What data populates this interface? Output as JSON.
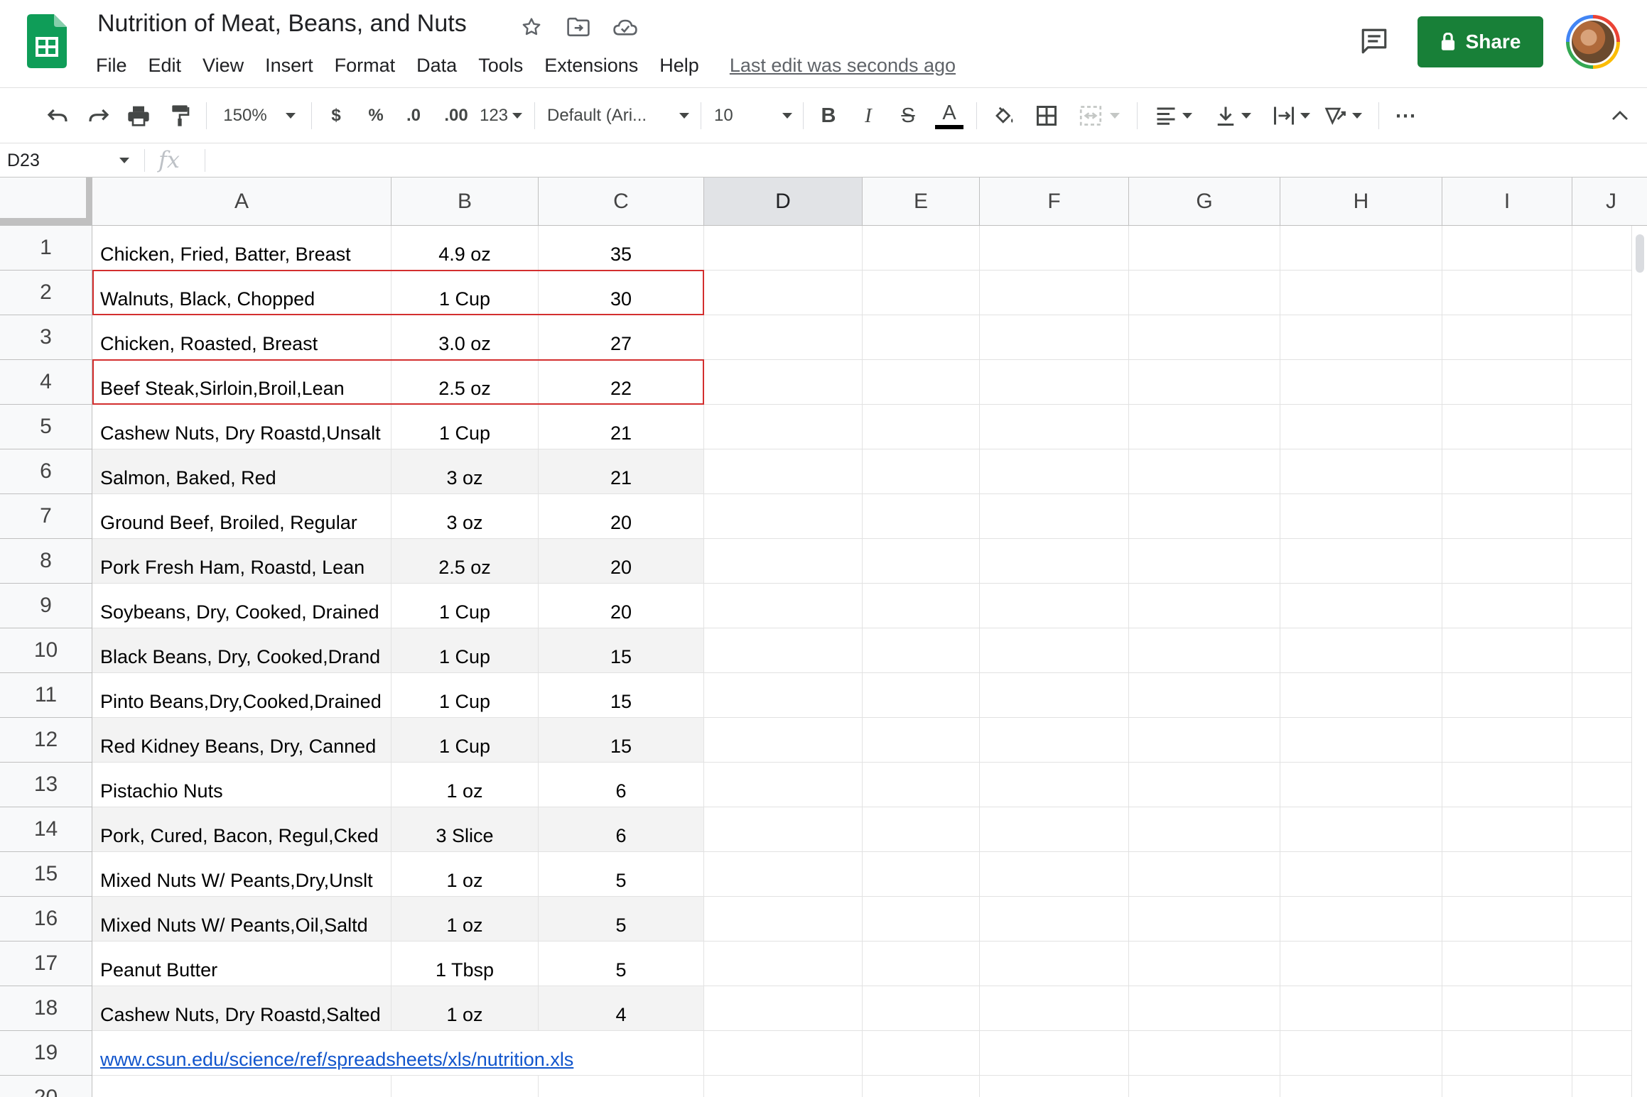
{
  "document": {
    "title": "Nutrition of Meat, Beans, and Nuts"
  },
  "menu": [
    "File",
    "Edit",
    "View",
    "Insert",
    "Format",
    "Data",
    "Tools",
    "Extensions",
    "Help"
  ],
  "status": {
    "last_edit": "Last edit was seconds ago"
  },
  "share": {
    "label": "Share"
  },
  "toolbar": {
    "zoom": "150%",
    "currency": "$",
    "percent": "%",
    "decrease_decimal": ".0",
    "increase_decimal": ".00",
    "more_formats": "123",
    "font": "Default (Ari...",
    "font_size": "10",
    "bold": "B",
    "italic": "I",
    "strikethrough": "S",
    "text_color": "A",
    "more": "⋯"
  },
  "formula_bar": {
    "cell_ref": "D23",
    "fx": "fx",
    "value": ""
  },
  "grid": {
    "columns": [
      "A",
      "B",
      "C",
      "D",
      "E",
      "F",
      "G",
      "H",
      "I",
      "J"
    ],
    "selected_column": "D",
    "row_numbers": [
      "1",
      "2",
      "3",
      "4",
      "5",
      "6",
      "7",
      "8",
      "9",
      "10",
      "11",
      "12",
      "13",
      "14",
      "15",
      "16",
      "17",
      "18",
      "19",
      "20"
    ],
    "rows": [
      {
        "a": "Chicken, Fried, Batter, Breast",
        "b": "4.9 oz",
        "c": "35"
      },
      {
        "a": "Walnuts, Black, Chopped",
        "b": "1 Cup",
        "c": "30"
      },
      {
        "a": "Chicken, Roasted, Breast",
        "b": "3.0 oz",
        "c": "27"
      },
      {
        "a": "Beef Steak,Sirloin,Broil,Lean",
        "b": "2.5 oz",
        "c": "22"
      },
      {
        "a": "Cashew Nuts, Dry Roastd,Unsalt",
        "b": "1 Cup",
        "c": "21"
      },
      {
        "a": "Salmon, Baked, Red",
        "b": "3 oz",
        "c": "21"
      },
      {
        "a": "Ground Beef, Broiled, Regular",
        "b": "3 oz",
        "c": "20"
      },
      {
        "a": "Pork Fresh Ham, Roastd, Lean",
        "b": "2.5 oz",
        "c": "20"
      },
      {
        "a": "Soybeans, Dry, Cooked, Drained",
        "b": "1 Cup",
        "c": "20"
      },
      {
        "a": "Black Beans, Dry, Cooked,Drand",
        "b": "1 Cup",
        "c": "15"
      },
      {
        "a": "Pinto Beans,Dry,Cooked,Drained",
        "b": "1 Cup",
        "c": "15"
      },
      {
        "a": "Red Kidney Beans, Dry, Canned",
        "b": "1 Cup",
        "c": "15"
      },
      {
        "a": "Pistachio Nuts",
        "b": "1 oz",
        "c": "6"
      },
      {
        "a": "Pork, Cured, Bacon, Regul,Cked",
        "b": "3 Slice",
        "c": "6"
      },
      {
        "a": "Mixed Nuts W/ Peants,Dry,Unslt",
        "b": "1 oz",
        "c": "5"
      },
      {
        "a": "Mixed Nuts W/ Peants,Oil,Saltd",
        "b": "1 oz",
        "c": "5"
      },
      {
        "a": "Peanut Butter",
        "b": "1 Tbsp",
        "c": "5"
      },
      {
        "a": "Cashew Nuts, Dry Roastd,Salted",
        "b": "1 oz",
        "c": "4"
      }
    ],
    "source_link": "www.csun.edu/science/ref/spreadsheets/xls/nutrition.xls",
    "highlighted_rows": [
      "2",
      "4"
    ]
  },
  "colors": {
    "accent_green": "#188038",
    "sheets_logo_green": "#0f9d58",
    "highlight_border": "#d32f2f",
    "link_blue": "#1155cc",
    "banded_row": "#f3f3f3"
  }
}
